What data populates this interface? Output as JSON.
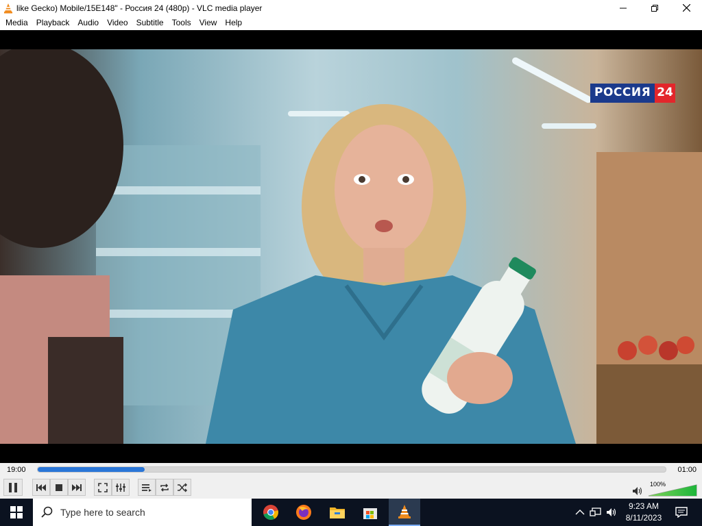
{
  "window": {
    "title": "like Gecko) Mobile/15E148\" - Россия 24 (480p) - VLC media player"
  },
  "menu": {
    "items": [
      "Media",
      "Playback",
      "Audio",
      "Video",
      "Subtitle",
      "Tools",
      "View",
      "Help"
    ]
  },
  "video": {
    "channel_logo_name": "РОССИЯ",
    "channel_logo_number": "24",
    "logo_colors": {
      "blue": "#1b3a8c",
      "red": "#e3262b"
    }
  },
  "playback": {
    "elapsed": "19:00",
    "total": "01:00",
    "progress": 0.17,
    "state": "playing",
    "accent": "#2a76d8"
  },
  "volume": {
    "label": "100%",
    "level": 1.0
  },
  "controls": {
    "icons": [
      "pause-icon",
      "previous-icon",
      "stop-icon",
      "next-icon",
      "fullscreen-icon",
      "extended-settings-icon",
      "playlist-icon",
      "loop-icon",
      "shuffle-icon"
    ]
  },
  "taskbar": {
    "search_placeholder": "Type here to search",
    "apps": [
      "chrome-icon",
      "firefox-icon",
      "file-explorer-icon",
      "microsoft-store-icon",
      "vlc-icon"
    ],
    "time": "9:23 AM",
    "date": "8/11/2023"
  }
}
